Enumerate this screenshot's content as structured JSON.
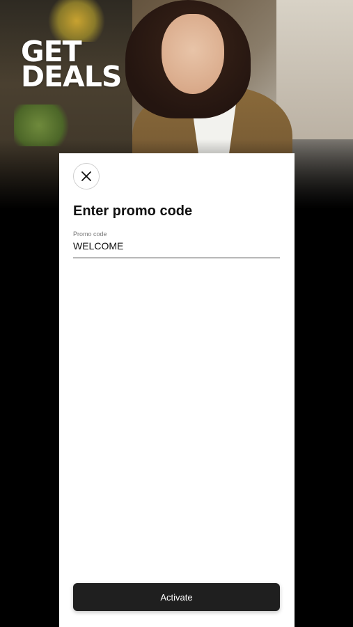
{
  "hero": {
    "title_line1": "GET",
    "title_line2": "DEALS"
  },
  "sheet": {
    "close_icon": "close-icon",
    "title": "Enter promo code",
    "promo_field": {
      "label": "Promo code",
      "value": "WELCOME"
    },
    "activate_label": "Activate"
  },
  "colors": {
    "background": "#000000",
    "sheet": "#ffffff",
    "button": "#1f1f1f",
    "field_underline": "#b8b8b8"
  }
}
